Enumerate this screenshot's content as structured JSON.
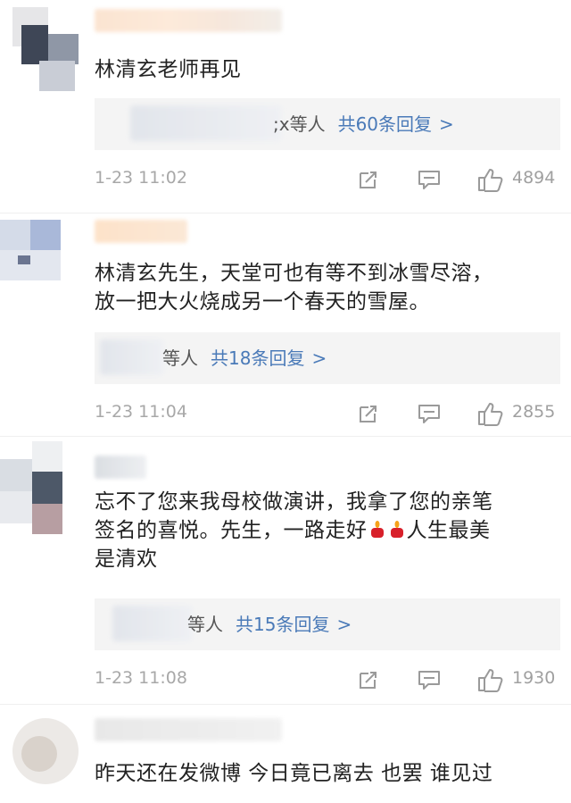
{
  "comments": [
    {
      "text_lines": [
        "林清玄老师再见"
      ],
      "reply": {
        "who": ";x等人",
        "count": "共60条回复",
        "arrow": ">"
      },
      "time": "1-23 11:02",
      "likes": "4894"
    },
    {
      "text_lines": [
        "林清玄先生，天堂可也有等不到冰雪尽溶，",
        "放一把大火烧成另一个春天的雪屋。"
      ],
      "reply": {
        "who": "等人",
        "count": "共18条回复",
        "arrow": ">"
      },
      "time": "1-23 11:04",
      "likes": "2855"
    },
    {
      "text_lines": [
        "忘不了您来我母校做演讲，我拿了您的亲笔",
        "签名的喜悦。先生，一路走好",
        "人生最美",
        "是清欢"
      ],
      "reply": {
        "who": "等人",
        "count": "共15条回复",
        "arrow": ">"
      },
      "time": "1-23 11:08",
      "likes": "1930"
    },
    {
      "text_lines": [
        "昨天还在发微博 今日竟已离去  也罢 谁见过"
      ]
    }
  ],
  "icons": {
    "repost": "share-icon",
    "comment": "comment-icon",
    "like": "thumbs-up-icon",
    "emoji": "candle-emoji-icon"
  },
  "colors": {
    "link": "#4a7ab8",
    "meta": "#a8a8a8",
    "reply_bg": "#f4f4f4"
  }
}
